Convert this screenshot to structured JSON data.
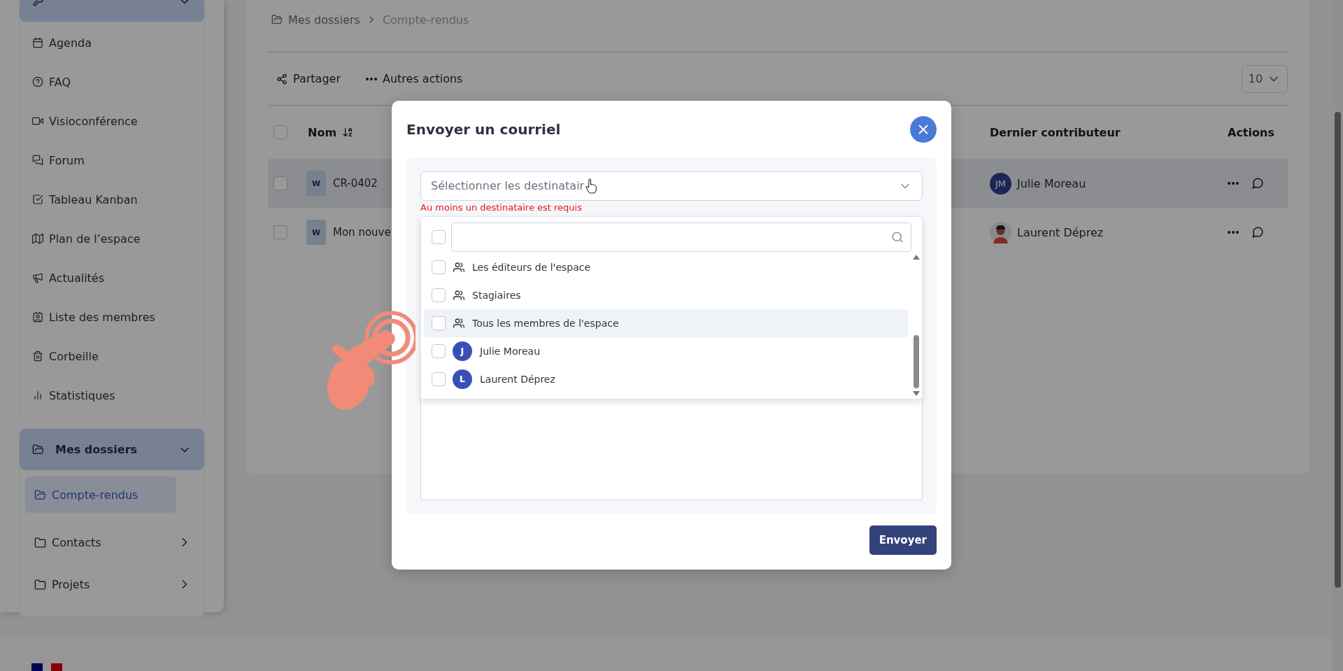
{
  "sidebar": {
    "tools_header": {
      "expanded": true
    },
    "tools": [
      {
        "label": "Agenda"
      },
      {
        "label": "FAQ"
      },
      {
        "label": "Visioconférence"
      },
      {
        "label": "Forum"
      },
      {
        "label": "Tableau Kanban"
      },
      {
        "label": "Plan de l’espace"
      },
      {
        "label": "Actualités"
      },
      {
        "label": "Liste des membres"
      },
      {
        "label": "Corbeille"
      },
      {
        "label": "Statistiques"
      }
    ],
    "folders_header": {
      "label": "Mes dossiers",
      "expanded": true
    },
    "folders": [
      {
        "label": "Compte-rendus",
        "selected": true,
        "has_children": false
      },
      {
        "label": "Contacts",
        "selected": false,
        "has_children": true
      },
      {
        "label": "Projets",
        "selected": false,
        "has_children": true
      }
    ]
  },
  "breadcrumb": [
    "Mes dossiers",
    "Compte-rendus"
  ],
  "toolbar": {
    "actions": [
      {
        "kind": "share",
        "label": "Partager"
      },
      {
        "kind": "more",
        "label": "Autres actions"
      }
    ],
    "page_size": "10"
  },
  "table": {
    "columns": {
      "name": "Nom",
      "contributor": "Dernier contributeur",
      "actions": "Actions"
    },
    "header_checked": false,
    "rows": [
      {
        "badge": "W",
        "name": "CR-0402",
        "contributor": "Julie Moreau",
        "avatar": {
          "kind": "initials",
          "text": "JM"
        },
        "highlighted": true,
        "checked": false
      },
      {
        "badge": "W",
        "name": "Mon nouve",
        "contributor": "Laurent Déprez",
        "highlighted": false,
        "checked": false
      }
    ]
  },
  "modal": {
    "title": "Envoyer un courriel",
    "recipients": {
      "placeholder": "Sélectionner les destinatair",
      "error": "Au moins un destinataire est requis",
      "expanded": true,
      "select_all_checked": false
    },
    "options": [
      {
        "kind": "group",
        "label": "Les éditeurs de l'espace",
        "checked": false,
        "highlighted": false
      },
      {
        "kind": "group",
        "label": "Stagiaires",
        "checked": false,
        "highlighted": false
      },
      {
        "kind": "group",
        "label": "Tous les membres de l'espace",
        "checked": false,
        "highlighted": true
      },
      {
        "kind": "user",
        "initial": "J",
        "label": "Julie Moreau",
        "checked": false,
        "highlighted": false
      },
      {
        "kind": "user",
        "initial": "L",
        "label": "Laurent Déprez",
        "checked": false,
        "highlighted": false
      }
    ],
    "submit": "Envoyer"
  }
}
